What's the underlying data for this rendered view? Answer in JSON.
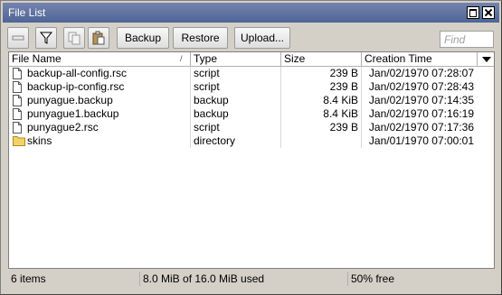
{
  "window": {
    "title": "File List"
  },
  "toolbar": {
    "backup_label": "Backup",
    "restore_label": "Restore",
    "upload_label": "Upload...",
    "find_placeholder": "Find"
  },
  "table": {
    "columns": [
      "File Name",
      "Type",
      "Size",
      "Creation Time"
    ],
    "sort_indicator": "/",
    "rows": [
      {
        "name": "backup-all-config.rsc",
        "type": "script",
        "size": "239 B",
        "time": "Jan/02/1970 07:28:07",
        "icon": "file-icon"
      },
      {
        "name": "backup-ip-config.rsc",
        "type": "script",
        "size": "239 B",
        "time": "Jan/02/1970 07:28:43",
        "icon": "file-icon"
      },
      {
        "name": "punyague.backup",
        "type": "backup",
        "size": "8.4 KiB",
        "time": "Jan/02/1970 07:14:35",
        "icon": "file-icon"
      },
      {
        "name": "punyague1.backup",
        "type": "backup",
        "size": "8.4 KiB",
        "time": "Jan/02/1970 07:16:19",
        "icon": "file-icon"
      },
      {
        "name": "punyague2.rsc",
        "type": "script",
        "size": "239 B",
        "time": "Jan/02/1970 07:17:36",
        "icon": "file-icon"
      },
      {
        "name": "skins",
        "type": "directory",
        "size": "",
        "time": "Jan/01/1970 07:00:01",
        "icon": "folder-icon"
      }
    ]
  },
  "status": {
    "items": "6 items",
    "usage": "8.0 MiB of 16.0 MiB used",
    "free": "50% free"
  },
  "colors": {
    "titlebar": "#5b6f9c",
    "folder": "#f2d36b"
  }
}
